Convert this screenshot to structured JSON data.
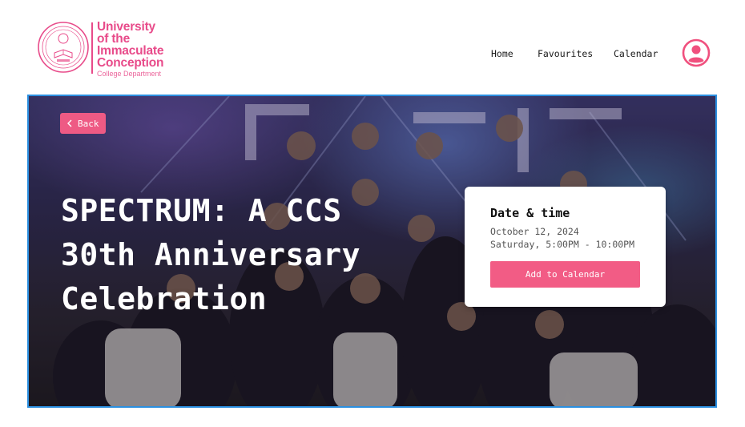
{
  "brand": {
    "name_lines": [
      "University",
      "of the",
      "Immaculate",
      "Conception"
    ],
    "department": "College Department",
    "accent_color": "#e84b8a",
    "seal_icon": "university-seal"
  },
  "nav": {
    "home": "Home",
    "favourites": "Favourites",
    "calendar": "Calendar",
    "profile_icon": "user-circle-icon"
  },
  "hero": {
    "back_label": "Back",
    "title": "SPECTRUM: A CCS 30th Anniversary Celebration",
    "image_subject": "group photo"
  },
  "event": {
    "heading": "Date & time",
    "date": "October 12, 2024",
    "time": "Saturday, 5:00PM - 10:00PM",
    "add_label": "Add to Calendar",
    "button_color": "#f25c85"
  },
  "theme": {
    "hero_border": "#2b8fe0"
  }
}
